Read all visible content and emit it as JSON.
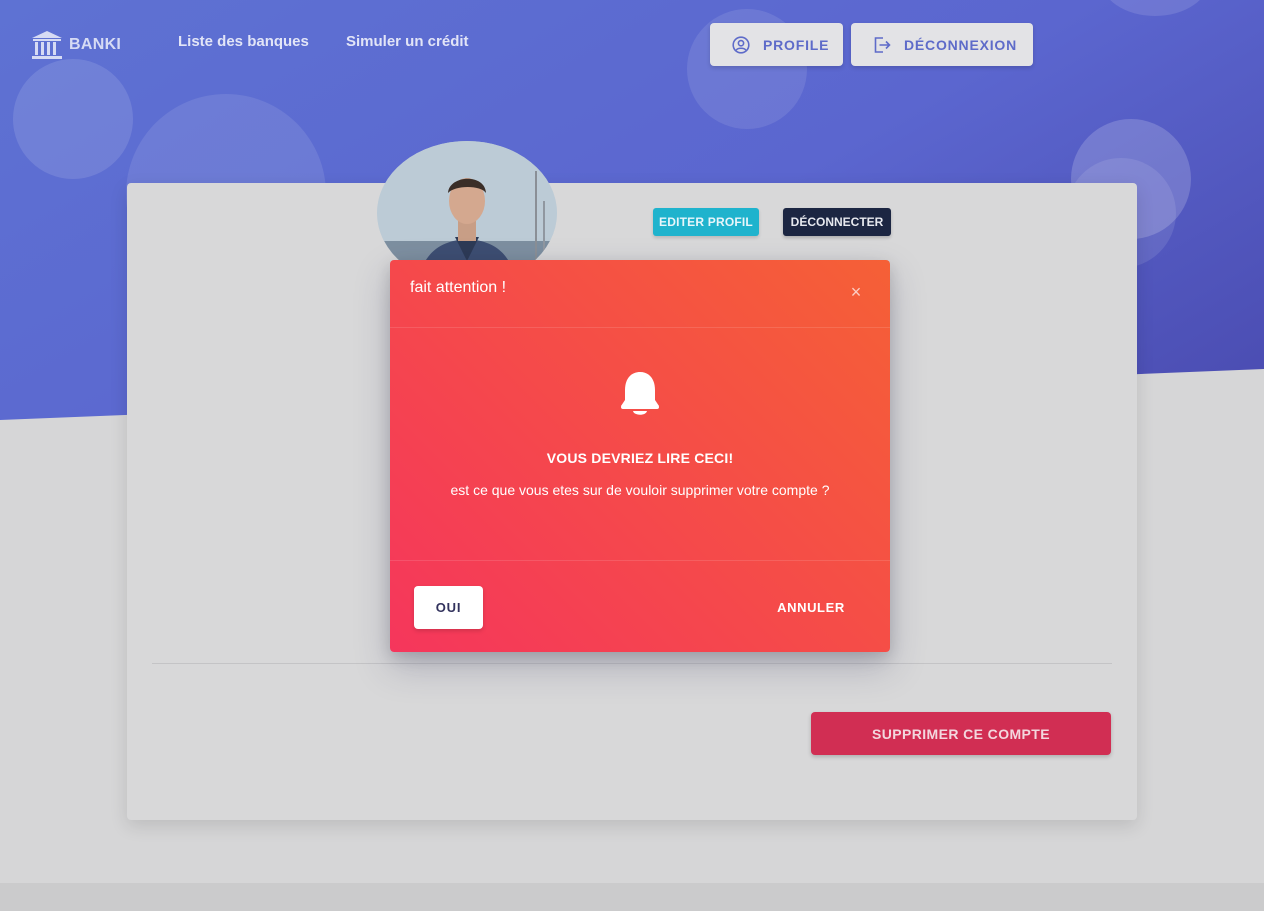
{
  "brand": {
    "name": "BANKI"
  },
  "nav": {
    "links": [
      {
        "label": "Liste des banques"
      },
      {
        "label": "Simuler un crédit"
      }
    ],
    "profile_button": "PROFILE",
    "logout_button": "DÉCONNEXION"
  },
  "profile_card": {
    "edit_button": "EDITER PROFIL",
    "disconnect_button": "DÉCONNECTER",
    "delete_button": "SUPPRIMER CE COMPTE"
  },
  "modal": {
    "title": "fait attention !",
    "close": "×",
    "icon": "bell-icon",
    "heading": "VOUS DEVRIEZ LIRE CECI!",
    "message": "est ce que vous etes sur de vouloir supprimer votre compte ?",
    "confirm_button": "OUI",
    "cancel_button": "ANNULER"
  },
  "colors": {
    "hero_start": "#5e72d3",
    "hero_end": "#4a4bb0",
    "modal_gradient_start": "#f5365c",
    "modal_gradient_end": "#f56036",
    "info": "#1fb3cd",
    "dark": "#1c2642",
    "danger": "#d12e53"
  }
}
